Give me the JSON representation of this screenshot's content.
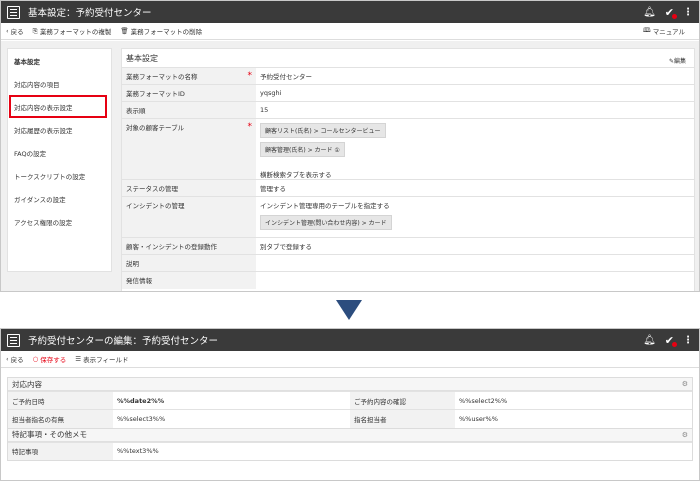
{
  "top": {
    "title": "基本設定：予約受付センター",
    "toolbar": {
      "back": "戻る",
      "copy": "業務フォーマットの複製",
      "delete": "業務フォーマットの削除",
      "manual": "マニュアル"
    },
    "sidebar": {
      "heading": "基本設定",
      "items": [
        "対応内容の項目",
        "対応内容の表示設定",
        "対応履歴の表示設定",
        "FAQの設定",
        "トークスクリプトの設定",
        "ガイダンスの設定",
        "アクセス権限の設定"
      ]
    },
    "main": {
      "title": "基本設定",
      "edit": "編集",
      "rows": {
        "name": {
          "label": "業務フォーマットの名称",
          "value": "予約受付センター"
        },
        "id": {
          "label": "業務フォーマットID",
          "value": "yqsghi"
        },
        "order": {
          "label": "表示順",
          "value": "15"
        },
        "table": {
          "label": "対象の顧客テーブル",
          "chip1": "顧客リスト(氏名) > コールセンタービュー",
          "chip2": "顧客管理(氏名) > カード ①",
          "note": "横断検索タブを表示する"
        },
        "status": {
          "label": "ステータスの管理",
          "value": "管理する"
        },
        "incident": {
          "label": "インシデントの管理",
          "value": "インシデント管理専用のテーブルを指定する",
          "chip": "インシデント管理(問い合わせ内容) > カード"
        },
        "register": {
          "label": "顧客・インシデントの登録動作",
          "value": "別タブで登録する"
        },
        "desc": {
          "label": "説明",
          "value": ""
        },
        "sender": {
          "label": "発信情報",
          "value": ""
        }
      }
    }
  },
  "bottom": {
    "title": "予約受付センターの編集：予約受付センター",
    "toolbar": {
      "back": "戻る",
      "save": "保存する",
      "fields": "表示フィールド"
    },
    "sections": [
      {
        "title": "対応内容",
        "rows": [
          {
            "l1": "ご予約日時",
            "v1": "%%date2%%",
            "l2": "ご予約内容の確認",
            "v2": "%%select2%%"
          },
          {
            "l1": "担当者指名の有無",
            "v1": "%%select3%%",
            "l2": "指名担当者",
            "v2": "%%user%%"
          }
        ]
      },
      {
        "title": "特記事項・その他メモ",
        "rows": [
          {
            "l1": "特記事項",
            "v1": "%%text3%%"
          }
        ]
      }
    ]
  },
  "colors": {
    "titlebar": "#3a3a3a",
    "accent_red": "#e60012",
    "arrow": "#2c4d7e"
  }
}
